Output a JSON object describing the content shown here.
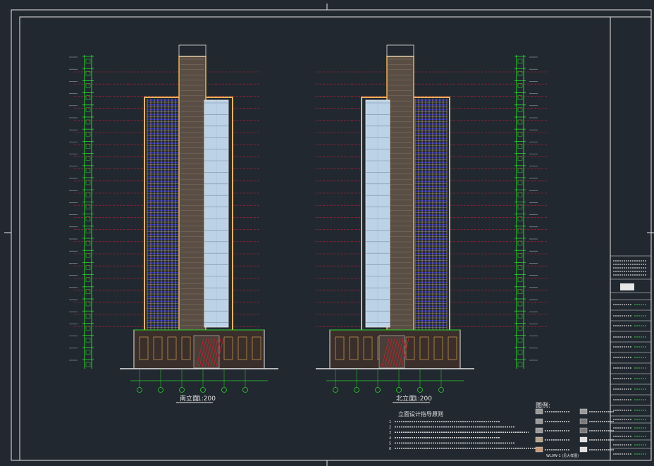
{
  "drawing": {
    "left_elevation_title": "南立面",
    "right_elevation_title": "北立面",
    "scale": "1:200"
  },
  "notes": {
    "title": "立面设计指导原则",
    "items": [
      "1",
      "2",
      "3",
      "4",
      "5",
      "6"
    ]
  },
  "legend": {
    "title": "图例:",
    "items": [
      "WL0W-1 (见大样图)"
    ]
  },
  "colors": {
    "background": "#212830",
    "frame": "#e6e6e6",
    "facade_outline": "#e8b25a",
    "glass": "#bcd2e6",
    "dim_green": "#2bd62b",
    "level_line": "#c81e3a",
    "window_blue": "#2a2fb8",
    "core_fill": "#5a4e44",
    "podium_fill": "#3a2f2a"
  }
}
